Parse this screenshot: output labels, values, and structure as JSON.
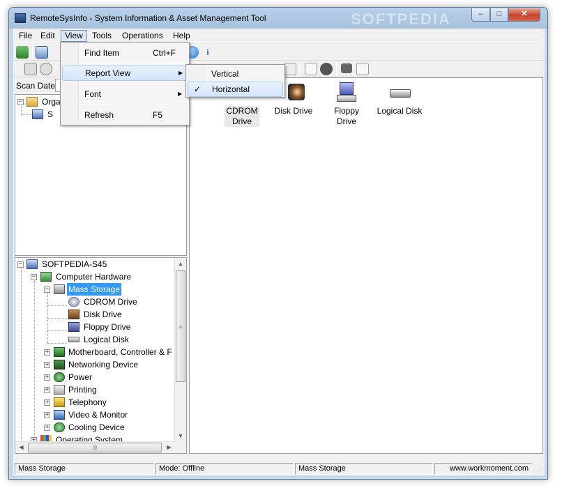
{
  "window": {
    "title": "RemoteSysInfo - System Information & Asset Management Tool",
    "watermark": "SOFTPEDIA",
    "controls": {
      "minimize": "–",
      "maximize": "□",
      "close": "✕"
    }
  },
  "menubar": {
    "items": [
      {
        "label": "File"
      },
      {
        "label": "Edit"
      },
      {
        "label": "View"
      },
      {
        "label": "Tools"
      },
      {
        "label": "Operations"
      },
      {
        "label": "Help"
      }
    ]
  },
  "scan": {
    "label": "Scan Date:"
  },
  "org_tree": {
    "root_label": "Orga",
    "child_label": "S"
  },
  "tree": {
    "root": "SOFTPEDIA-S45",
    "computer_hardware": "Computer Hardware",
    "mass_storage": "Mass Storage",
    "cdrom": "CDROM Drive",
    "disk": "Disk Drive",
    "floppy": "Floppy Drive",
    "logical": "Logical Disk",
    "motherboard": "Motherboard, Controller & F",
    "networking": "Networking Device",
    "power": "Power",
    "printing": "Printing",
    "telephony": "Telephony",
    "video": "Video & Monitor",
    "cooling": "Cooling Device",
    "os": "Operating System"
  },
  "main": {
    "items": [
      {
        "label": "CDROM Drive"
      },
      {
        "label": "Disk Drive"
      },
      {
        "label": "Floppy Drive"
      },
      {
        "label": "Logical Disk"
      }
    ]
  },
  "view_menu": {
    "find_item": "Find Item",
    "find_shortcut": "Ctrl+F",
    "report_view": "Report View",
    "font": "Font",
    "refresh": "Refresh",
    "refresh_shortcut": "F5"
  },
  "report_submenu": {
    "vertical": "Vertical",
    "horizontal": "Horizontal",
    "checked": "✓"
  },
  "statusbar": {
    "cell1": "Mass Storage",
    "cell2": "Mode: Offline",
    "cell3": "Mass Storage",
    "cell4": "www.workmoment.com"
  },
  "colors": {
    "selection": "#3399ff",
    "menu_hover": "#d3e4fa"
  }
}
